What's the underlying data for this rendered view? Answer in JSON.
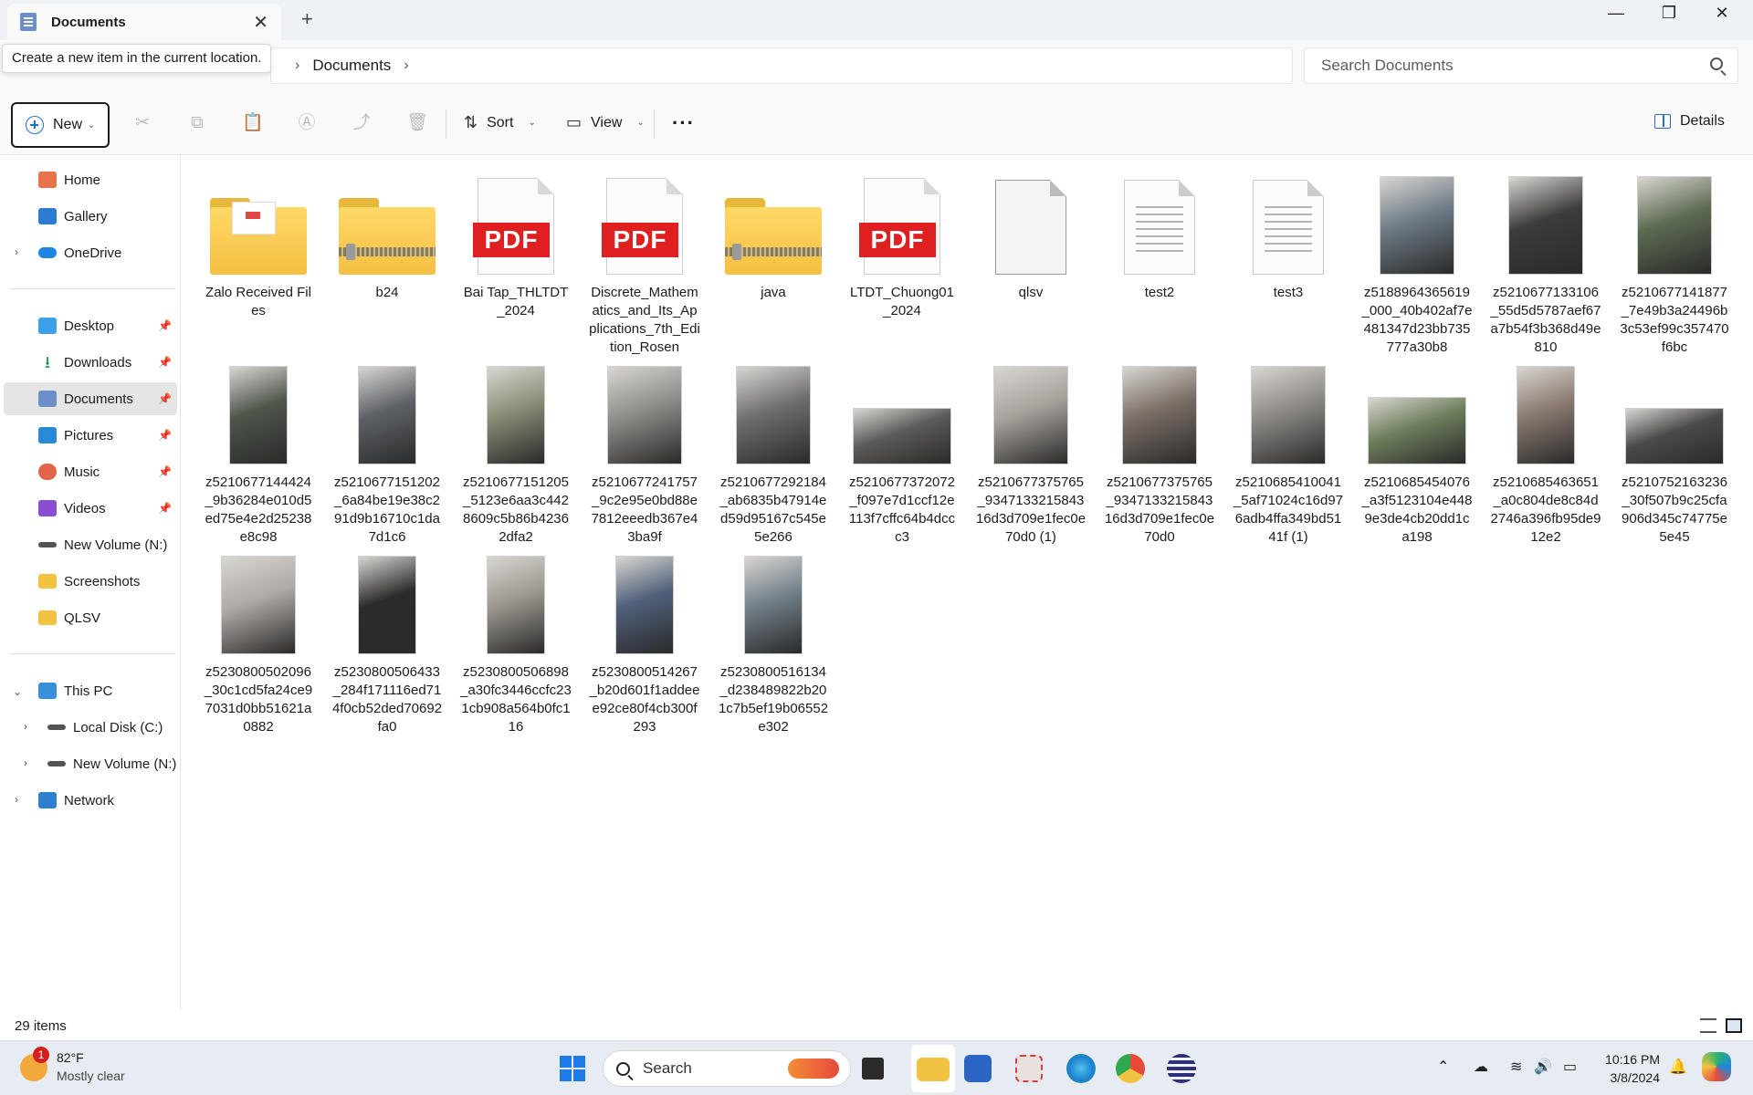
{
  "window": {
    "tab_title": "Documents",
    "tab_icon": "documents-folder-icon"
  },
  "tooltip": "Create a new item in the current location.",
  "address": {
    "current": "Documents"
  },
  "search": {
    "placeholder": "Search Documents"
  },
  "commandbar": {
    "new_label": "New",
    "sort_label": "Sort",
    "view_label": "View",
    "details_label": "Details"
  },
  "nav": {
    "home": "Home",
    "gallery": "Gallery",
    "onedrive": "OneDrive",
    "desktop": "Desktop",
    "downloads": "Downloads",
    "documents": "Documents",
    "pictures": "Pictures",
    "music": "Music",
    "videos": "Videos",
    "new_volume": "New Volume (N:)",
    "screenshots": "Screenshots",
    "qlsv": "QLSV",
    "this_pc": "This PC",
    "local_disk": "Local Disk (C:)",
    "new_volume_2": "New Volume (N:)",
    "network": "Network"
  },
  "files": [
    {
      "name": "Zalo Received Files",
      "type": "folder-doc"
    },
    {
      "name": "b24",
      "type": "folder-zip"
    },
    {
      "name": "Bai Tap_THLTDT_2024",
      "type": "pdf"
    },
    {
      "name": "Discrete_Mathematics_and_Its_Applications_7th_Edition_Rosen",
      "type": "pdf"
    },
    {
      "name": "java",
      "type": "folder-zip"
    },
    {
      "name": "LTDT_Chuong01_2024",
      "type": "pdf"
    },
    {
      "name": "qlsv",
      "type": "blank"
    },
    {
      "name": "test2",
      "type": "txt"
    },
    {
      "name": "test3",
      "type": "txt"
    },
    {
      "name": "z5188964365619_000_40b402af7e481347d23bb735777a30b8",
      "type": "photo"
    },
    {
      "name": "z5210677133106_55d5d5787aef67a7b54f3b368d49e810",
      "type": "photo"
    },
    {
      "name": "z5210677141877_7e49b3a24496b3c53ef99c357470f6bc",
      "type": "photo"
    },
    {
      "name": "z5210677144424_9b36284e010d5ed75e4e2d25238e8c98",
      "type": "photo"
    },
    {
      "name": "z5210677151202_6a84be19e38c291d9b16710c1da7d1c6",
      "type": "photo"
    },
    {
      "name": "z5210677151205_5123e6aa3c4428609c5b86b42362dfa2",
      "type": "photo"
    },
    {
      "name": "z5210677241757_9c2e95e0bd88e7812eeedb367e43ba9f",
      "type": "photo"
    },
    {
      "name": "z5210677292184_ab6835b47914ed59d95167c545e5e266",
      "type": "photo"
    },
    {
      "name": "z5210677372072_f097e7d1ccf12e113f7cffc64b4dccc3",
      "type": "photo"
    },
    {
      "name": "z5210677375765_934713321584316d3d709e1fec0e70d0 (1)",
      "type": "photo"
    },
    {
      "name": "z5210677375765_934713321584316d3d709e1fec0e70d0",
      "type": "photo"
    },
    {
      "name": "z5210685410041_5af71024c16d976adb4ffa349bd5141f (1)",
      "type": "photo"
    },
    {
      "name": "z5210685454076_a3f5123104e4489e3de4cb20dd1ca198",
      "type": "photo"
    },
    {
      "name": "z5210685463651_a0c804de8c84d2746a396fb95de912e2",
      "type": "photo"
    },
    {
      "name": "z5210752163236_30f507b9c25cfa906d345c74775e5e45",
      "type": "photo"
    },
    {
      "name": "z5230800502096_30c1cd5fa24ce97031d0bb51621a0882",
      "type": "photo"
    },
    {
      "name": "z5230800506433_284f171116ed714f0cb52ded70692fa0",
      "type": "photo"
    },
    {
      "name": "z5230800506898_a30fc3446ccfc231cb908a564b0fc116",
      "type": "photo"
    },
    {
      "name": "z5230800514267_b20d601f1addeee92ce80f4cb300f293",
      "type": "photo"
    },
    {
      "name": "z5230800516134_d238489822b201c7b5ef19b06552e302",
      "type": "photo"
    }
  ],
  "status": {
    "item_count": "29 items"
  },
  "taskbar": {
    "weather_temp": "82°F",
    "weather_cond": "Mostly clear",
    "weather_badge": "1",
    "search_label": "Search",
    "time": "10:16 PM",
    "date": "3/8/2024"
  }
}
